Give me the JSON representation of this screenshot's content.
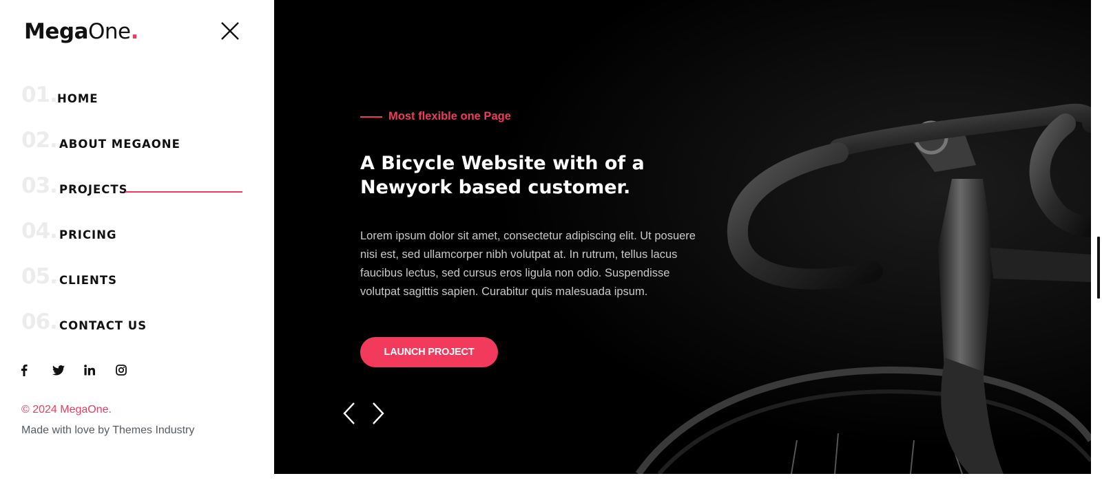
{
  "brand": {
    "bold": "Mega",
    "light": "One",
    "dot": "."
  },
  "nav": {
    "items": [
      {
        "num": "01.",
        "label": "HOME"
      },
      {
        "num": "02.",
        "label": "ABOUT MEGAONE"
      },
      {
        "num": "03.",
        "label": "PROJECTS",
        "active": true
      },
      {
        "num": "04.",
        "label": "PRICING"
      },
      {
        "num": "05.",
        "label": "CLIENTS"
      },
      {
        "num": "06.",
        "label": "CONTACT US"
      }
    ]
  },
  "social": [
    "facebook-icon",
    "twitter-icon",
    "linkedin-icon",
    "instagram-icon"
  ],
  "footer": {
    "copyright": "© 2024 MegaOne.",
    "credit": "Made with love by Themes Industry"
  },
  "hero": {
    "eyebrow": "Most flexible one Page",
    "title": "A Bicycle Website with of a Newyork based customer.",
    "text": "Lorem ipsum dolor sit amet, consectetur adipiscing elit. Ut posuere nisi est, sed ullamcorper nibh volutpat at. In rutrum, tellus lacus faucibus lectus, sed cursus eros ligula non odio. Suspendisse volutpat sagittis sapien. Curabitur quis malesuada ipsum.",
    "button": "LAUNCH PROJECT"
  },
  "colors": {
    "accent": "#f23a5d",
    "dark": "#000000",
    "text": "#111111"
  }
}
